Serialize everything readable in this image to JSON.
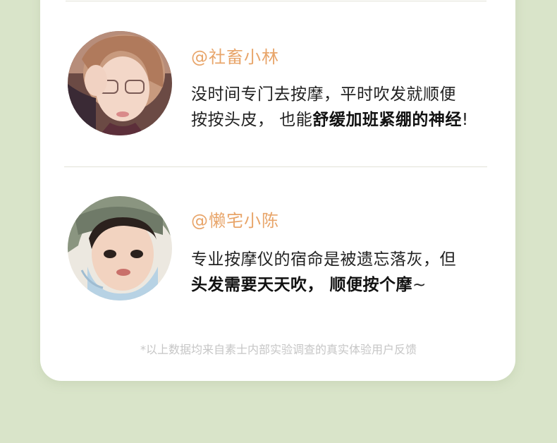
{
  "reviews": [
    {
      "username": "@社畜小林",
      "line1": "没时间专门去按摩，平时吹发就顺便",
      "line2_plain": "按按头皮，  也能",
      "line2_bold": "舒缓加班紧绷的神经",
      "line2_tail": "!"
    },
    {
      "username": "@懒宅小陈",
      "line1": "专业按摩仪的宿命是被遗忘落灰，但",
      "line2_bold": "头发需要天天吹，  顺便按个摩",
      "line2_tail": "~"
    }
  ],
  "footnote": "*以上数据均来自素士内部实验调查的真实体验用户反馈",
  "colors": {
    "background": "#d9e4c9",
    "card": "#ffffff",
    "username": "#e8a56a",
    "footnote": "#c6c6c6"
  }
}
